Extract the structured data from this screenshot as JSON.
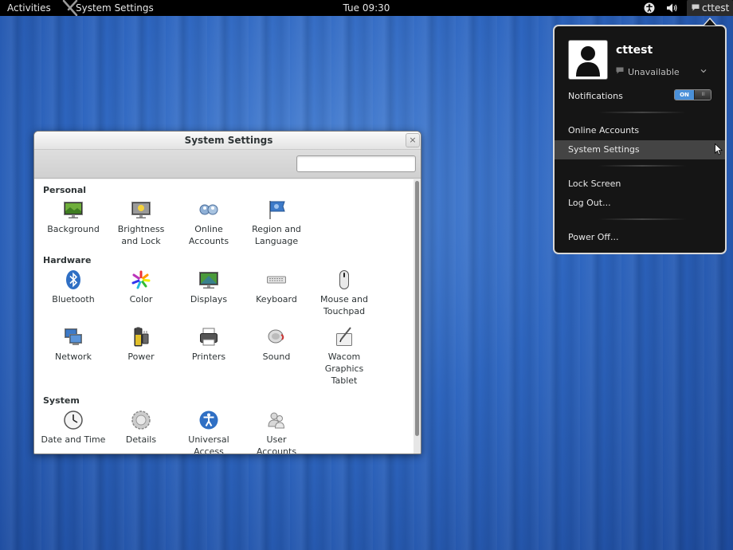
{
  "topbar": {
    "activities": "Activities",
    "app_name": "System Settings",
    "clock": "Tue 09:30",
    "user": "cttest"
  },
  "user_menu": {
    "username": "cttest",
    "status": "Unavailable",
    "notifications_label": "Notifications",
    "notifications_toggle": "ON",
    "notifications_on": true,
    "items": [
      {
        "label": "Online Accounts"
      },
      {
        "label": "System Settings",
        "highlighted": true
      },
      {
        "label": "Lock Screen"
      },
      {
        "label": "Log Out..."
      },
      {
        "label": "Power Off..."
      }
    ]
  },
  "window": {
    "title": "System Settings",
    "close": "×",
    "search_placeholder": ""
  },
  "categories": [
    {
      "name": "Personal",
      "items": [
        {
          "label": "Background",
          "icon": "background-icon"
        },
        {
          "label": "Brightness and Lock",
          "icon": "brightness-icon"
        },
        {
          "label": "Online Accounts",
          "icon": "online-accounts-icon"
        },
        {
          "label": "Region and Language",
          "icon": "region-flag-icon"
        }
      ]
    },
    {
      "name": "Hardware",
      "items": [
        {
          "label": "Bluetooth",
          "icon": "bluetooth-icon"
        },
        {
          "label": "Color",
          "icon": "color-icon"
        },
        {
          "label": "Displays",
          "icon": "displays-icon"
        },
        {
          "label": "Keyboard",
          "icon": "keyboard-icon"
        },
        {
          "label": "Mouse and Touchpad",
          "icon": "mouse-icon"
        },
        {
          "label": "Network",
          "icon": "network-icon"
        },
        {
          "label": "Power",
          "icon": "power-icon"
        },
        {
          "label": "Printers",
          "icon": "printer-icon"
        },
        {
          "label": "Sound",
          "icon": "sound-icon"
        },
        {
          "label": "Wacom Graphics Tablet",
          "icon": "wacom-tablet-icon"
        }
      ]
    },
    {
      "name": "System",
      "items": [
        {
          "label": "Date and Time",
          "icon": "clock-icon"
        },
        {
          "label": "Details",
          "icon": "details-icon"
        },
        {
          "label": "Universal Access",
          "icon": "universal-access-icon"
        },
        {
          "label": "User Accounts",
          "icon": "user-accounts-icon"
        }
      ]
    }
  ],
  "colors": {
    "desktop": "#2e66c0",
    "menu_bg": "#151515",
    "toggle_on": "#4a90d9",
    "menu_highlight": "#444444"
  }
}
